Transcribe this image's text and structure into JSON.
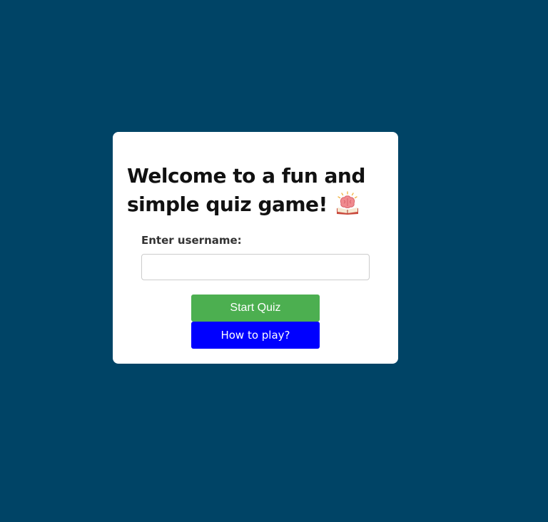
{
  "card": {
    "title": "Welcome to a fun and simple quiz game!",
    "title_icon": "brain-book-icon",
    "username_label": "Enter username:",
    "username_value": "",
    "username_placeholder": "",
    "start_button": "Start Quiz",
    "howto_button": "How to play?"
  },
  "colors": {
    "background": "#004466",
    "card": "#ffffff",
    "start_button": "#4caf50",
    "howto_button": "#0000ff"
  }
}
